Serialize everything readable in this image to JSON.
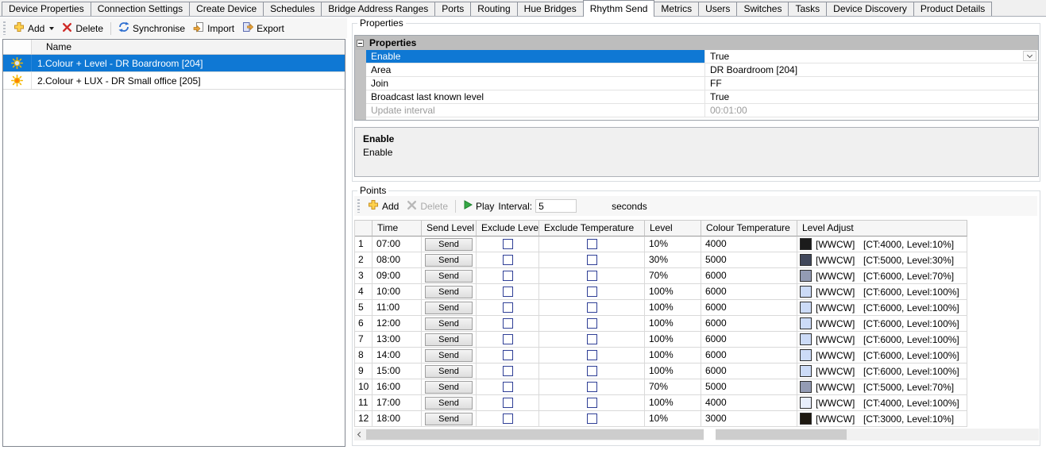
{
  "tabs": {
    "active_index": 8,
    "items": [
      "Device Properties",
      "Connection Settings",
      "Create Device",
      "Schedules",
      "Bridge Address Ranges",
      "Ports",
      "Routing",
      "Hue Bridges",
      "Rhythm Send",
      "Metrics",
      "Users",
      "Switches",
      "Tasks",
      "Device Discovery",
      "Product Details"
    ]
  },
  "left_panel": {
    "toolbar": {
      "add_label": "Add",
      "delete_label": "Delete",
      "synchronise_label": "Synchronise",
      "import_label": "Import",
      "export_label": "Export"
    },
    "list": {
      "header": "Name",
      "items": [
        {
          "label": "1.Colour + Level - DR Boardroom [204]",
          "selected": true,
          "icon": "sun-icon",
          "icon_center": "#cfe2ff"
        },
        {
          "label": "2.Colour + LUX - DR Small office [205]",
          "selected": false,
          "icon": "sun-icon",
          "icon_center": "#ff8400"
        }
      ]
    }
  },
  "properties_section": {
    "group_label": "Properties",
    "grid": {
      "category": "Properties",
      "rows": [
        {
          "name": "Enable",
          "value": "True",
          "selected": true,
          "has_combo": true
        },
        {
          "name": "Area",
          "value": "DR Boardroom [204]"
        },
        {
          "name": "Join",
          "value": "FF"
        },
        {
          "name": "Broadcast last known level",
          "value": "True"
        },
        {
          "name": "Update interval",
          "value": "00:01:00",
          "disabled": true
        }
      ]
    },
    "description": {
      "title": "Enable",
      "text": "Enable"
    }
  },
  "points_section": {
    "group_label": "Points",
    "toolbar": {
      "add_label": "Add",
      "delete_label": "Delete",
      "delete_disabled": true,
      "play_label": "Play",
      "interval_label": "Interval:",
      "interval_value": "5",
      "seconds_label": "seconds"
    },
    "table": {
      "headers": [
        "",
        "Time",
        "Send Level",
        "Exclude Level",
        "Exclude Temperature",
        "Level",
        "Colour Temperature",
        "Level Adjust"
      ],
      "send_label": "Send",
      "rows": [
        {
          "num": "1",
          "time": "07:00",
          "exclude_level": false,
          "exclude_temperature": false,
          "level": "10%",
          "colour_temperature": "4000",
          "swatch": "#1b1b1b",
          "swatch_tag": "[WWCW]",
          "adjust": "[CT:4000, Level:10%]"
        },
        {
          "num": "2",
          "time": "08:00",
          "exclude_level": false,
          "exclude_temperature": false,
          "level": "30%",
          "colour_temperature": "5000",
          "swatch": "#40475a",
          "swatch_tag": "[WWCW]",
          "adjust": "[CT:5000, Level:30%]"
        },
        {
          "num": "3",
          "time": "09:00",
          "exclude_level": false,
          "exclude_temperature": false,
          "level": "70%",
          "colour_temperature": "6000",
          "swatch": "#939bb4",
          "swatch_tag": "[WWCW]",
          "adjust": "[CT:6000, Level:70%]"
        },
        {
          "num": "4",
          "time": "10:00",
          "exclude_level": false,
          "exclude_temperature": false,
          "level": "100%",
          "colour_temperature": "6000",
          "swatch": "#ccdbf7",
          "swatch_tag": "[WWCW]",
          "adjust": "[CT:6000, Level:100%]"
        },
        {
          "num": "5",
          "time": "11:00",
          "exclude_level": false,
          "exclude_temperature": false,
          "level": "100%",
          "colour_temperature": "6000",
          "swatch": "#ccdbf7",
          "swatch_tag": "[WWCW]",
          "adjust": "[CT:6000, Level:100%]"
        },
        {
          "num": "6",
          "time": "12:00",
          "exclude_level": false,
          "exclude_temperature": false,
          "level": "100%",
          "colour_temperature": "6000",
          "swatch": "#ccdbf7",
          "swatch_tag": "[WWCW]",
          "adjust": "[CT:6000, Level:100%]"
        },
        {
          "num": "7",
          "time": "13:00",
          "exclude_level": false,
          "exclude_temperature": false,
          "level": "100%",
          "colour_temperature": "6000",
          "swatch": "#ccdbf7",
          "swatch_tag": "[WWCW]",
          "adjust": "[CT:6000, Level:100%]"
        },
        {
          "num": "8",
          "time": "14:00",
          "exclude_level": false,
          "exclude_temperature": false,
          "level": "100%",
          "colour_temperature": "6000",
          "swatch": "#ccdbf7",
          "swatch_tag": "[WWCW]",
          "adjust": "[CT:6000, Level:100%]"
        },
        {
          "num": "9",
          "time": "15:00",
          "exclude_level": false,
          "exclude_temperature": false,
          "level": "100%",
          "colour_temperature": "6000",
          "swatch": "#ccdbf7",
          "swatch_tag": "[WWCW]",
          "adjust": "[CT:6000, Level:100%]"
        },
        {
          "num": "10",
          "time": "16:00",
          "exclude_level": false,
          "exclude_temperature": false,
          "level": "70%",
          "colour_temperature": "5000",
          "swatch": "#939bb4",
          "swatch_tag": "[WWCW]",
          "adjust": "[CT:5000, Level:70%]"
        },
        {
          "num": "11",
          "time": "17:00",
          "exclude_level": false,
          "exclude_temperature": false,
          "level": "100%",
          "colour_temperature": "4000",
          "swatch": "#e8eefb",
          "swatch_tag": "[WWCW]",
          "adjust": "[CT:4000, Level:100%]"
        },
        {
          "num": "12",
          "time": "18:00",
          "exclude_level": false,
          "exclude_temperature": false,
          "level": "10%",
          "colour_temperature": "3000",
          "swatch": "#1d1810",
          "swatch_tag": "[WWCW]",
          "adjust": "[CT:3000, Level:10%]"
        }
      ]
    }
  },
  "colors": {
    "selection": "#0f78d4",
    "disabled_text": "#9b9b9b",
    "sun_ray": "#f5b800"
  }
}
